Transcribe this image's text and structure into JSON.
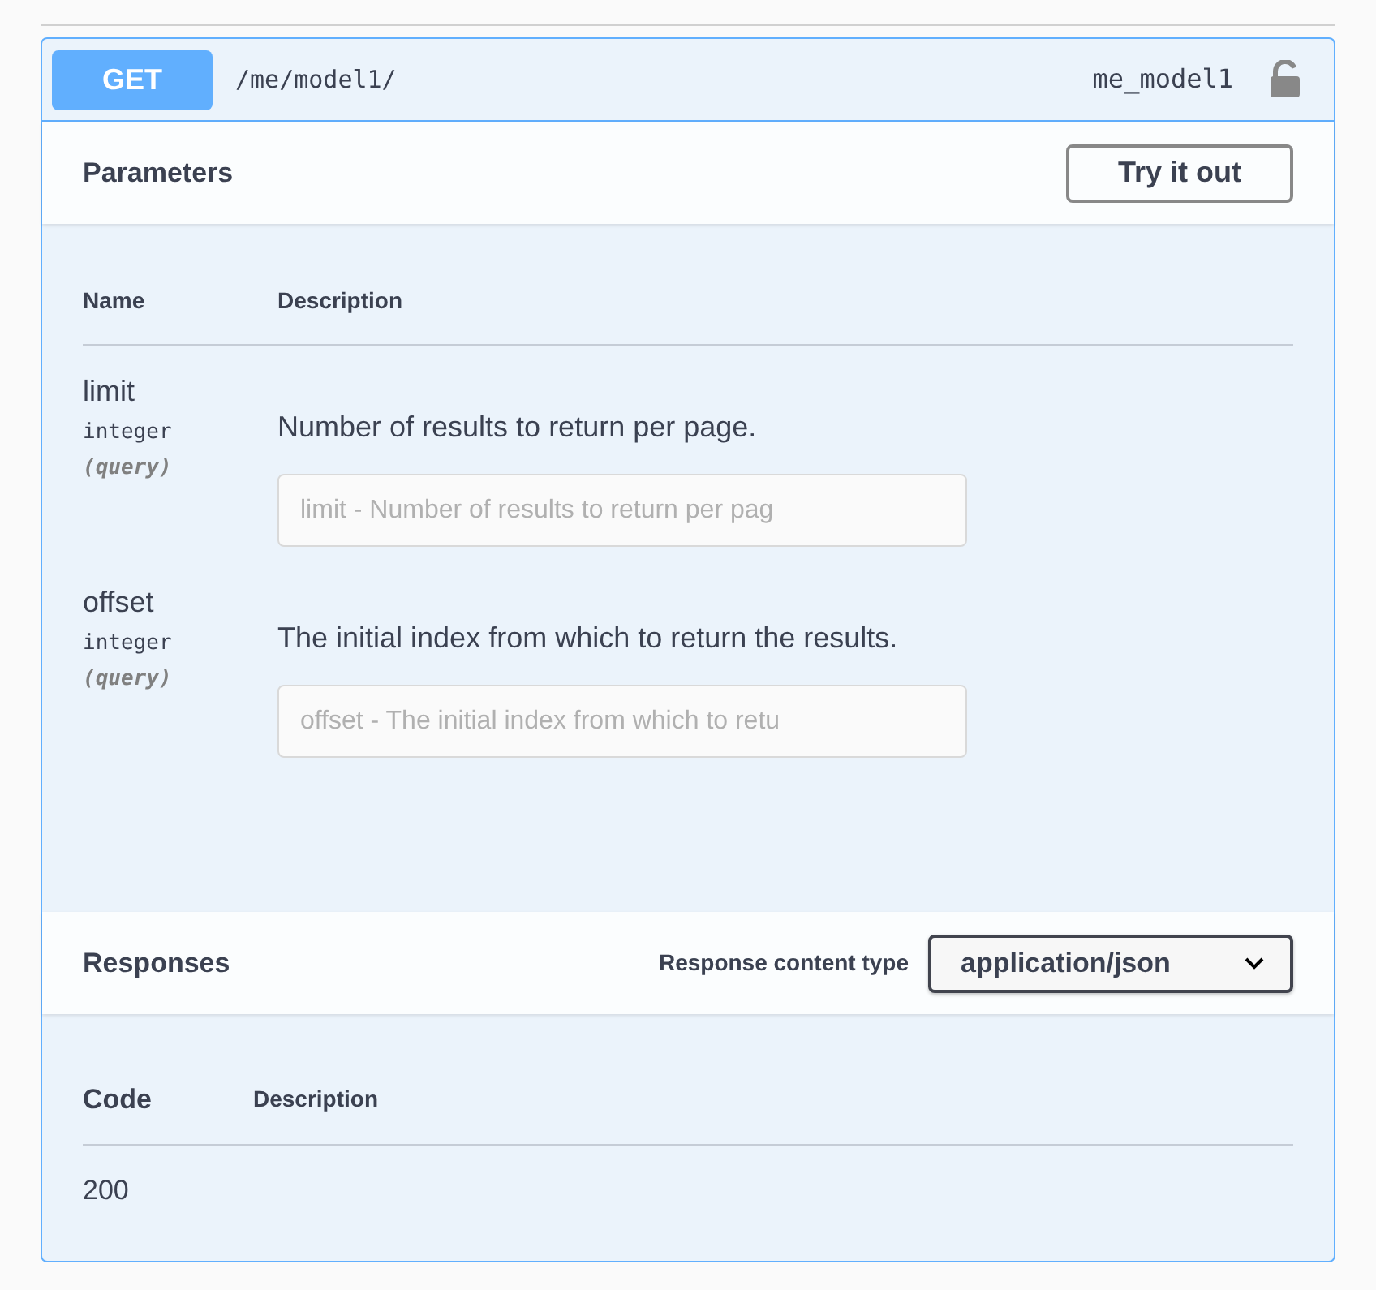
{
  "operation": {
    "method": "GET",
    "path": "/me/model1/",
    "operation_id": "me_model1"
  },
  "parameters": {
    "title": "Parameters",
    "try_button": "Try it out",
    "columns": [
      "Name",
      "Description"
    ],
    "rows": [
      {
        "name": "limit",
        "type": "integer",
        "location": "(query)",
        "description": "Number of results to return per page.",
        "placeholder": "limit - Number of results to return per pag"
      },
      {
        "name": "offset",
        "type": "integer",
        "location": "(query)",
        "description": "The initial index from which to return the results.",
        "placeholder": "offset - The initial index from which to retu"
      }
    ]
  },
  "responses": {
    "title": "Responses",
    "content_type_label": "Response content type",
    "content_type": "application/json",
    "columns": [
      "Code",
      "Description"
    ],
    "rows": [
      {
        "code": "200"
      }
    ]
  }
}
